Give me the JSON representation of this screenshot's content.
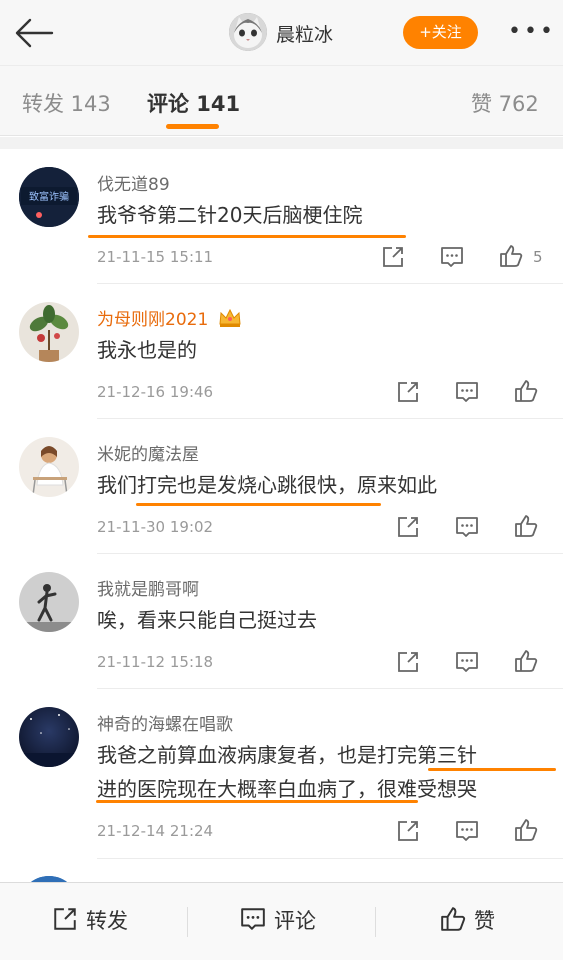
{
  "header": {
    "user_name": "晨粒冰",
    "follow_label": "+关注",
    "more_label": "•••"
  },
  "tabs": [
    {
      "label": "转发 143"
    },
    {
      "label": "评论 141"
    },
    {
      "label": "赞 762"
    }
  ],
  "comments": [
    {
      "name": "伐无道89",
      "text": "我爷爷第二针20天后脑梗住院",
      "time": "21-11-15 15:11",
      "likes": "5",
      "avatar_text": "致富诈骗"
    },
    {
      "name": "为母则刚2021",
      "text": "我永也是的",
      "time": "21-12-16 19:46",
      "likes": ""
    },
    {
      "name": "米妮的魔法屋",
      "text": "我们打完也是发烧心跳很快，原来如此",
      "time": "21-11-30 19:02",
      "likes": ""
    },
    {
      "name": "我就是鹏哥啊",
      "text": "唉，看来只能自己挺过去",
      "time": "21-11-12 15:18",
      "likes": ""
    },
    {
      "name": "神奇的海螺在唱歌",
      "text_line1": "我爸之前算血液病康复者，也是打完第三针",
      "text_line2": "进的医院现在大概率白血病了，很难受想哭",
      "time": "21-12-14 21:24",
      "likes": ""
    }
  ],
  "bottom_bar": {
    "repost_label": "转发",
    "comment_label": "评论",
    "like_label": "赞"
  },
  "colors": {
    "accent": "#ff8200",
    "vip_name": "#e86b0c"
  }
}
